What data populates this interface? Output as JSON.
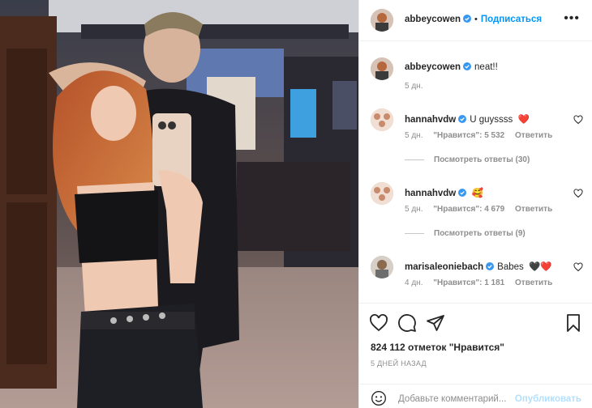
{
  "post": {
    "author": "abbeycowen",
    "follow_label": "Подписаться",
    "dot": "•",
    "more_icon": "more-horizontal-icon"
  },
  "caption": {
    "user": "abbeycowen",
    "text": "neat!!",
    "time": "5 дн."
  },
  "comments": [
    {
      "user": "hannahvdw",
      "text": "U guyssss",
      "emoji": "❤️",
      "time": "5 дн.",
      "likes": "\"Нравится\": 5 532",
      "reply_label": "Ответить",
      "view_replies": "Посмотреть ответы (30)"
    },
    {
      "user": "hannahvdw",
      "text": "",
      "emoji": "🥰",
      "time": "5 дн.",
      "likes": "\"Нравится\": 4 679",
      "reply_label": "Ответить",
      "view_replies": "Посмотреть ответы (9)"
    },
    {
      "user": "marisaleoniebach",
      "text": "Babes",
      "emoji": "🖤❤️",
      "time": "4 дн.",
      "likes": "\"Нравится\": 1 181",
      "reply_label": "Ответить"
    }
  ],
  "stats": {
    "likes": "824 112 отметок \"Нравится\"",
    "posted_ago": "5 ДНЕЙ НАЗАД"
  },
  "composer": {
    "placeholder": "Добавьте комментарий...",
    "post_label": "Опубликовать"
  },
  "colors": {
    "verified": "#3897f0",
    "link": "#0095f6",
    "heart_red": "#ed4956",
    "muted": "#8e8e8e"
  }
}
